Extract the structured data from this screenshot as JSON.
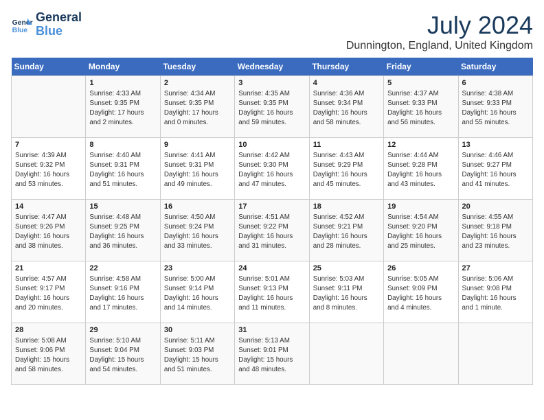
{
  "header": {
    "logo_line1": "General",
    "logo_line2": "Blue",
    "month": "July 2024",
    "location": "Dunnington, England, United Kingdom"
  },
  "days_of_week": [
    "Sunday",
    "Monday",
    "Tuesday",
    "Wednesday",
    "Thursday",
    "Friday",
    "Saturday"
  ],
  "weeks": [
    [
      {
        "day": "",
        "sunrise": "",
        "sunset": "",
        "daylight": ""
      },
      {
        "day": "1",
        "sunrise": "Sunrise: 4:33 AM",
        "sunset": "Sunset: 9:35 PM",
        "daylight": "Daylight: 17 hours and 2 minutes."
      },
      {
        "day": "2",
        "sunrise": "Sunrise: 4:34 AM",
        "sunset": "Sunset: 9:35 PM",
        "daylight": "Daylight: 17 hours and 0 minutes."
      },
      {
        "day": "3",
        "sunrise": "Sunrise: 4:35 AM",
        "sunset": "Sunset: 9:35 PM",
        "daylight": "Daylight: 16 hours and 59 minutes."
      },
      {
        "day": "4",
        "sunrise": "Sunrise: 4:36 AM",
        "sunset": "Sunset: 9:34 PM",
        "daylight": "Daylight: 16 hours and 58 minutes."
      },
      {
        "day": "5",
        "sunrise": "Sunrise: 4:37 AM",
        "sunset": "Sunset: 9:33 PM",
        "daylight": "Daylight: 16 hours and 56 minutes."
      },
      {
        "day": "6",
        "sunrise": "Sunrise: 4:38 AM",
        "sunset": "Sunset: 9:33 PM",
        "daylight": "Daylight: 16 hours and 55 minutes."
      }
    ],
    [
      {
        "day": "7",
        "sunrise": "Sunrise: 4:39 AM",
        "sunset": "Sunset: 9:32 PM",
        "daylight": "Daylight: 16 hours and 53 minutes."
      },
      {
        "day": "8",
        "sunrise": "Sunrise: 4:40 AM",
        "sunset": "Sunset: 9:31 PM",
        "daylight": "Daylight: 16 hours and 51 minutes."
      },
      {
        "day": "9",
        "sunrise": "Sunrise: 4:41 AM",
        "sunset": "Sunset: 9:31 PM",
        "daylight": "Daylight: 16 hours and 49 minutes."
      },
      {
        "day": "10",
        "sunrise": "Sunrise: 4:42 AM",
        "sunset": "Sunset: 9:30 PM",
        "daylight": "Daylight: 16 hours and 47 minutes."
      },
      {
        "day": "11",
        "sunrise": "Sunrise: 4:43 AM",
        "sunset": "Sunset: 9:29 PM",
        "daylight": "Daylight: 16 hours and 45 minutes."
      },
      {
        "day": "12",
        "sunrise": "Sunrise: 4:44 AM",
        "sunset": "Sunset: 9:28 PM",
        "daylight": "Daylight: 16 hours and 43 minutes."
      },
      {
        "day": "13",
        "sunrise": "Sunrise: 4:46 AM",
        "sunset": "Sunset: 9:27 PM",
        "daylight": "Daylight: 16 hours and 41 minutes."
      }
    ],
    [
      {
        "day": "14",
        "sunrise": "Sunrise: 4:47 AM",
        "sunset": "Sunset: 9:26 PM",
        "daylight": "Daylight: 16 hours and 38 minutes."
      },
      {
        "day": "15",
        "sunrise": "Sunrise: 4:48 AM",
        "sunset": "Sunset: 9:25 PM",
        "daylight": "Daylight: 16 hours and 36 minutes."
      },
      {
        "day": "16",
        "sunrise": "Sunrise: 4:50 AM",
        "sunset": "Sunset: 9:24 PM",
        "daylight": "Daylight: 16 hours and 33 minutes."
      },
      {
        "day": "17",
        "sunrise": "Sunrise: 4:51 AM",
        "sunset": "Sunset: 9:22 PM",
        "daylight": "Daylight: 16 hours and 31 minutes."
      },
      {
        "day": "18",
        "sunrise": "Sunrise: 4:52 AM",
        "sunset": "Sunset: 9:21 PM",
        "daylight": "Daylight: 16 hours and 28 minutes."
      },
      {
        "day": "19",
        "sunrise": "Sunrise: 4:54 AM",
        "sunset": "Sunset: 9:20 PM",
        "daylight": "Daylight: 16 hours and 25 minutes."
      },
      {
        "day": "20",
        "sunrise": "Sunrise: 4:55 AM",
        "sunset": "Sunset: 9:18 PM",
        "daylight": "Daylight: 16 hours and 23 minutes."
      }
    ],
    [
      {
        "day": "21",
        "sunrise": "Sunrise: 4:57 AM",
        "sunset": "Sunset: 9:17 PM",
        "daylight": "Daylight: 16 hours and 20 minutes."
      },
      {
        "day": "22",
        "sunrise": "Sunrise: 4:58 AM",
        "sunset": "Sunset: 9:16 PM",
        "daylight": "Daylight: 16 hours and 17 minutes."
      },
      {
        "day": "23",
        "sunrise": "Sunrise: 5:00 AM",
        "sunset": "Sunset: 9:14 PM",
        "daylight": "Daylight: 16 hours and 14 minutes."
      },
      {
        "day": "24",
        "sunrise": "Sunrise: 5:01 AM",
        "sunset": "Sunset: 9:13 PM",
        "daylight": "Daylight: 16 hours and 11 minutes."
      },
      {
        "day": "25",
        "sunrise": "Sunrise: 5:03 AM",
        "sunset": "Sunset: 9:11 PM",
        "daylight": "Daylight: 16 hours and 8 minutes."
      },
      {
        "day": "26",
        "sunrise": "Sunrise: 5:05 AM",
        "sunset": "Sunset: 9:09 PM",
        "daylight": "Daylight: 16 hours and 4 minutes."
      },
      {
        "day": "27",
        "sunrise": "Sunrise: 5:06 AM",
        "sunset": "Sunset: 9:08 PM",
        "daylight": "Daylight: 16 hours and 1 minute."
      }
    ],
    [
      {
        "day": "28",
        "sunrise": "Sunrise: 5:08 AM",
        "sunset": "Sunset: 9:06 PM",
        "daylight": "Daylight: 15 hours and 58 minutes."
      },
      {
        "day": "29",
        "sunrise": "Sunrise: 5:10 AM",
        "sunset": "Sunset: 9:04 PM",
        "daylight": "Daylight: 15 hours and 54 minutes."
      },
      {
        "day": "30",
        "sunrise": "Sunrise: 5:11 AM",
        "sunset": "Sunset: 9:03 PM",
        "daylight": "Daylight: 15 hours and 51 minutes."
      },
      {
        "day": "31",
        "sunrise": "Sunrise: 5:13 AM",
        "sunset": "Sunset: 9:01 PM",
        "daylight": "Daylight: 15 hours and 48 minutes."
      },
      {
        "day": "",
        "sunrise": "",
        "sunset": "",
        "daylight": ""
      },
      {
        "day": "",
        "sunrise": "",
        "sunset": "",
        "daylight": ""
      },
      {
        "day": "",
        "sunrise": "",
        "sunset": "",
        "daylight": ""
      }
    ]
  ]
}
